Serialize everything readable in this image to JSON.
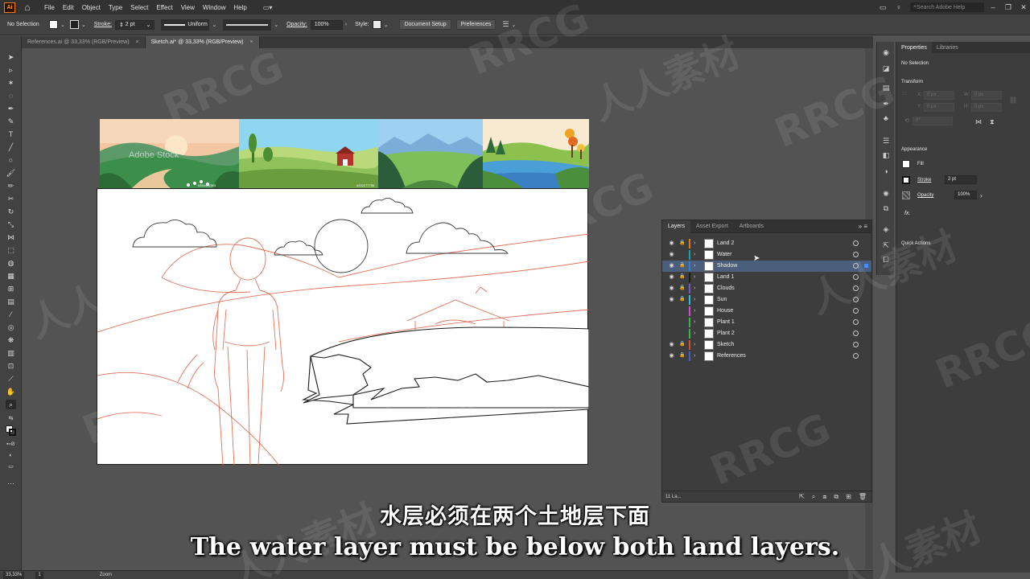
{
  "menubar": {
    "app_logo": "Ai",
    "items": [
      "File",
      "Edit",
      "Object",
      "Type",
      "Select",
      "Effect",
      "View",
      "Window",
      "Help"
    ],
    "workspace_switcher": "▭▾",
    "search_placeholder": "Search Adobe Help"
  },
  "controlbar": {
    "selection": "No Selection",
    "stroke_label": "Stroke:",
    "stroke_value": "2 pt",
    "profile_value": "Uniform",
    "opacity_label": "Opacity:",
    "opacity_value": "100%",
    "style_label": "Style:",
    "doc_setup": "Document Setup",
    "preferences": "Preferences"
  },
  "tabs": [
    {
      "label": "References.ai @ 33,33% (RGB/Preview)",
      "active": false
    },
    {
      "label": "Sketch.ai* @ 33,33% (RGB/Preview)",
      "active": true
    }
  ],
  "layers_panel": {
    "tabs": [
      "Layers",
      "Asset Export",
      "Artboards"
    ],
    "layers": [
      {
        "name": "Land 2",
        "color": "#e3771f",
        "visible": true,
        "locked": true,
        "selected": false
      },
      {
        "name": "Water",
        "color": "#16a0b0",
        "visible": true,
        "locked": false,
        "selected": false
      },
      {
        "name": "Shadow",
        "color": "#2f7fd2",
        "visible": true,
        "locked": true,
        "selected": true
      },
      {
        "name": "Land 1",
        "color": "#1b1b1b",
        "visible": true,
        "locked": true,
        "selected": false
      },
      {
        "name": "Clouds",
        "color": "#7a55c8",
        "visible": true,
        "locked": true,
        "selected": false
      },
      {
        "name": "Sun",
        "color": "#24c0e0",
        "visible": true,
        "locked": true,
        "selected": false
      },
      {
        "name": "House",
        "color": "#d24fd2",
        "visible": false,
        "locked": false,
        "selected": false
      },
      {
        "name": "Plant 1",
        "color": "#3bb54a",
        "visible": false,
        "locked": false,
        "selected": false
      },
      {
        "name": "Plant 2",
        "color": "#3bb54a",
        "visible": false,
        "locked": false,
        "selected": false
      },
      {
        "name": "Sketch",
        "color": "#e04c2b",
        "visible": true,
        "locked": true,
        "selected": false
      },
      {
        "name": "References",
        "color": "#3c5ed6",
        "visible": true,
        "locked": true,
        "selected": false
      }
    ],
    "count": "11 La..."
  },
  "properties_panel": {
    "tabs": [
      "Properties",
      "Libraries"
    ],
    "selection": "No Selection",
    "transform_title": "Transform",
    "x_label": "X:",
    "x_value": "0 px",
    "y_label": "Y:",
    "y_value": "0 px",
    "w_label": "W:",
    "w_value": "0 px",
    "h_label": "H:",
    "h_value": "0 px",
    "angle_value": "0°",
    "appearance_title": "Appearance",
    "fill_label": "Fill",
    "stroke_label": "Stroke",
    "stroke_value": "2 pt",
    "opacity_label": "Opacity",
    "opacity_value": "100%",
    "fx_label": "fx.",
    "quick_actions": "Quick Actions"
  },
  "statusbar": {
    "zoom": "33,33%",
    "artboard": "1",
    "tool": "Zoom"
  },
  "references": {
    "stock_text": "Adobe Stock",
    "id_1": "#354436303",
    "id_2": "#222277756"
  },
  "subtitles": {
    "zh": "水层必须在两个土地层下面",
    "en": "The water layer must be below both land layers."
  },
  "watermark": {
    "brand": "RRCG",
    "cn": "人人素材"
  },
  "colors": {
    "selection_blue": "#4b5f7d",
    "sketch_red": "#d85a3c",
    "ui_dark": "#323232",
    "canvas_gray": "#535353"
  }
}
